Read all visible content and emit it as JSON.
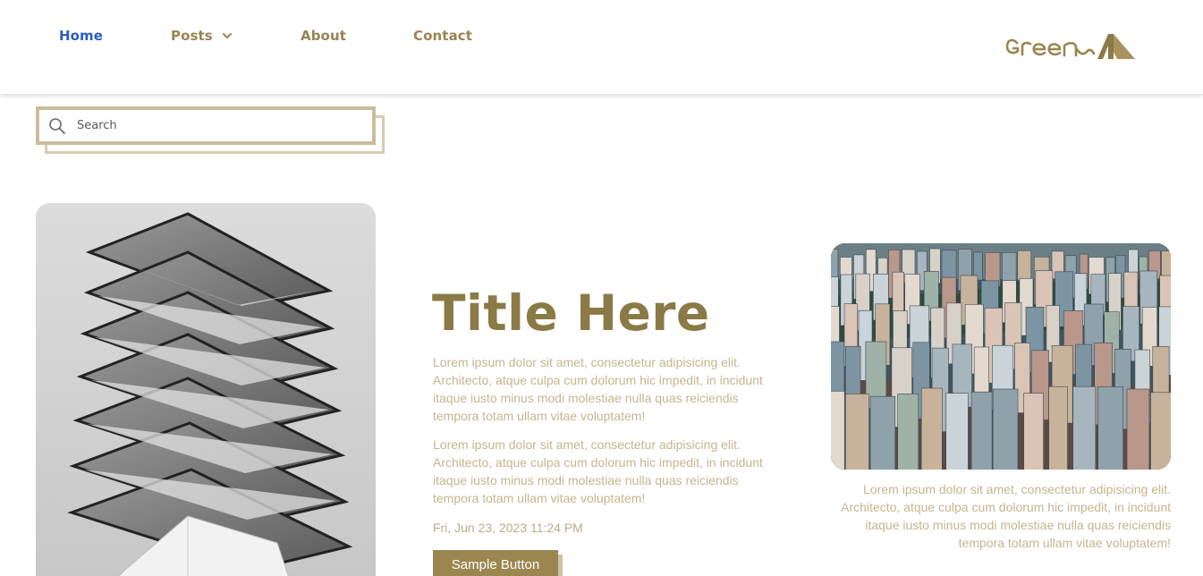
{
  "nav": {
    "home": "Home",
    "posts": "Posts",
    "about": "About",
    "contact": "Contact"
  },
  "logo_text": "green A",
  "search": {
    "placeholder": "Search",
    "value": ""
  },
  "hero": {
    "title": "Title Here",
    "paragraph1": "Lorem ipsum dolor sit amet, consectetur adipisicing elit. Architecto, atque culpa cum dolorum hic impedit, in incidunt itaque iusto minus modi molestiae nulla quas reiciendis tempora totam ullam vitae voluptatem!",
    "paragraph2": "Lorem ipsum dolor sit amet, consectetur adipisicing elit. Architecto, atque culpa cum dolorum hic impedit, in incidunt itaque iusto minus modi molestiae nulla quas reiciendis tempora totam ullam vitae voluptatem!",
    "date": "Fri, Jun 23, 2023 11:24 PM",
    "button_label": "Sample Button"
  },
  "right_caption": "Lorem ipsum dolor sit amet, consectetur adipisicing elit. Architecto, atque culpa cum dolorum hic impedit, in incidunt itaque iusto minus modi molestiae nulla quas reiciendis tempora totam ullam vitae voluptatem!",
  "colors": {
    "accent": "#9b8650",
    "nav_active": "#2a5cbf",
    "nav_text": "#9a8454",
    "body_text": "#c5b58e"
  },
  "icons": {
    "search": "search-icon",
    "dropdown": "chevron-down-icon"
  }
}
